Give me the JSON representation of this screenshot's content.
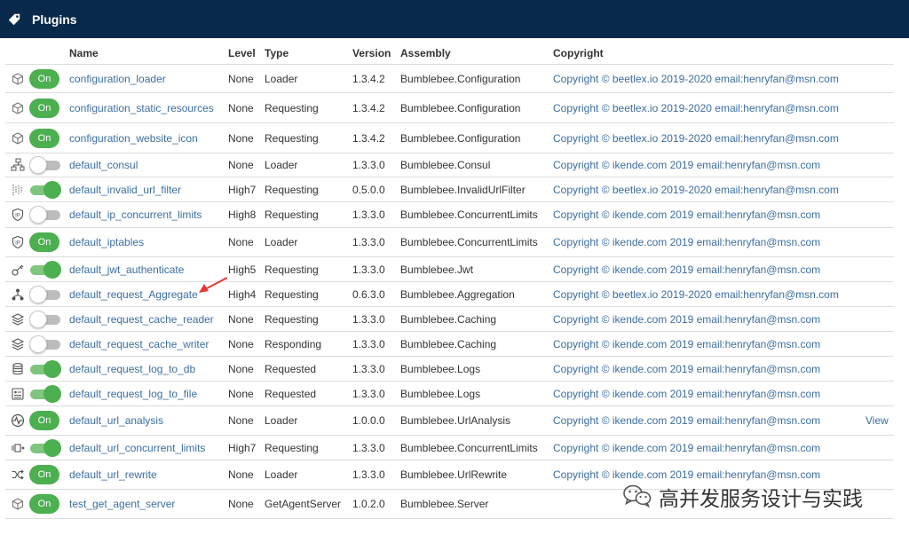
{
  "header": {
    "title": "Plugins",
    "icon": "tag-icon"
  },
  "columns": [
    "Name",
    "Level",
    "Type",
    "Version",
    "Assembly",
    "Copyright"
  ],
  "rows": [
    {
      "icon": "cube-icon",
      "switch": "on-button",
      "name": "configuration_loader",
      "level": "None",
      "type": "Loader",
      "version": "1.3.4.2",
      "assembly": "Bumblebee.Configuration",
      "copyright": "Copyright © beetlex.io 2019-2020 email:henryfan@msn.com",
      "view": ""
    },
    {
      "icon": "cube-icon",
      "switch": "on-button",
      "name": "configuration_static_resources",
      "level": "None",
      "type": "Requesting",
      "version": "1.3.4.2",
      "assembly": "Bumblebee.Configuration",
      "copyright": "Copyright © beetlex.io 2019-2020 email:henryfan@msn.com",
      "view": ""
    },
    {
      "icon": "cube-icon",
      "switch": "on-button",
      "name": "configuration_website_icon",
      "level": "None",
      "type": "Requesting",
      "version": "1.3.4.2",
      "assembly": "Bumblebee.Configuration",
      "copyright": "Copyright © beetlex.io 2019-2020 email:henryfan@msn.com",
      "view": ""
    },
    {
      "icon": "network-icon",
      "switch": "off",
      "name": "default_consul",
      "level": "None",
      "type": "Loader",
      "version": "1.3.3.0",
      "assembly": "Bumblebee.Consul",
      "copyright": "Copyright © ikende.com 2019 email:henryfan@msn.com",
      "view": ""
    },
    {
      "icon": "filter-icon",
      "switch": "on",
      "name": "default_invalid_url_filter",
      "level": "High7",
      "type": "Requesting",
      "version": "0.5.0.0",
      "assembly": "Bumblebee.InvalidUrlFilter",
      "copyright": "Copyright © beetlex.io 2019-2020 email:henryfan@msn.com",
      "view": ""
    },
    {
      "icon": "ip-shield-icon",
      "switch": "off",
      "name": "default_ip_concurrent_limits",
      "level": "High8",
      "type": "Requesting",
      "version": "1.3.3.0",
      "assembly": "Bumblebee.ConcurrentLimits",
      "copyright": "Copyright © ikende.com 2019 email:henryfan@msn.com",
      "view": ""
    },
    {
      "icon": "ip-shield-icon",
      "switch": "on-button",
      "name": "default_iptables",
      "level": "None",
      "type": "Loader",
      "version": "1.3.3.0",
      "assembly": "Bumblebee.ConcurrentLimits",
      "copyright": "Copyright © ikende.com 2019 email:henryfan@msn.com",
      "view": ""
    },
    {
      "icon": "key-icon",
      "switch": "on",
      "name": "default_jwt_authenticate",
      "level": "High5",
      "type": "Requesting",
      "version": "1.3.3.0",
      "assembly": "Bumblebee.Jwt",
      "copyright": "Copyright © ikende.com 2019 email:henryfan@msn.com",
      "view": ""
    },
    {
      "icon": "hierarchy-icon",
      "switch": "off",
      "name": "default_request_Aggregate",
      "level": "High4",
      "type": "Requesting",
      "version": "0.6.3.0",
      "assembly": "Bumblebee.Aggregation",
      "copyright": "Copyright © beetlex.io 2019-2020 email:henryfan@msn.com",
      "view": ""
    },
    {
      "icon": "layers-icon",
      "switch": "off",
      "name": "default_request_cache_reader",
      "level": "None",
      "type": "Requesting",
      "version": "1.3.3.0",
      "assembly": "Bumblebee.Caching",
      "copyright": "Copyright © ikende.com 2019 email:henryfan@msn.com",
      "view": ""
    },
    {
      "icon": "layers-icon",
      "switch": "off",
      "name": "default_request_cache_writer",
      "level": "None",
      "type": "Responding",
      "version": "1.3.3.0",
      "assembly": "Bumblebee.Caching",
      "copyright": "Copyright © ikende.com 2019 email:henryfan@msn.com",
      "view": ""
    },
    {
      "icon": "database-icon",
      "switch": "on",
      "name": "default_request_log_to_db",
      "level": "None",
      "type": "Requested",
      "version": "1.3.3.0",
      "assembly": "Bumblebee.Logs",
      "copyright": "Copyright © ikende.com 2019 email:henryfan@msn.com",
      "view": ""
    },
    {
      "icon": "file-log-icon",
      "switch": "on",
      "name": "default_request_log_to_file",
      "level": "None",
      "type": "Requested",
      "version": "1.3.3.0",
      "assembly": "Bumblebee.Logs",
      "copyright": "Copyright © ikende.com 2019 email:henryfan@msn.com",
      "view": ""
    },
    {
      "icon": "pulse-icon",
      "switch": "on-button",
      "name": "default_url_analysis",
      "level": "None",
      "type": "Loader",
      "version": "1.0.0.0",
      "assembly": "Bumblebee.UrlAnalysis",
      "copyright": "Copyright © ikende.com 2019 email:henryfan@msn.com",
      "view": "View"
    },
    {
      "icon": "throttle-icon",
      "switch": "on",
      "name": "default_url_concurrent_limits",
      "level": "High7",
      "type": "Requesting",
      "version": "1.3.3.0",
      "assembly": "Bumblebee.ConcurrentLimits",
      "copyright": "Copyright © ikende.com 2019 email:henryfan@msn.com",
      "view": ""
    },
    {
      "icon": "shuffle-icon",
      "switch": "on-button",
      "name": "default_url_rewrite",
      "level": "None",
      "type": "Loader",
      "version": "1.3.3.0",
      "assembly": "Bumblebee.UrlRewrite",
      "copyright": "Copyright © ikende.com 2019 email:henryfan@msn.com",
      "view": ""
    },
    {
      "icon": "cube-icon",
      "switch": "on-button",
      "name": "test_get_agent_server",
      "level": "None",
      "type": "GetAgentServer",
      "version": "1.0.2.0",
      "assembly": "Bumblebee.Server",
      "copyright": "",
      "view": ""
    }
  ],
  "switch_label_on": "On",
  "watermark": {
    "text": "高并发服务设计与实践",
    "icon": "wechat-icon"
  },
  "colors": {
    "header_bg": "#08294a",
    "switch_green": "#4caf50",
    "link": "#3c6e9f",
    "arrow": "#e53935"
  }
}
